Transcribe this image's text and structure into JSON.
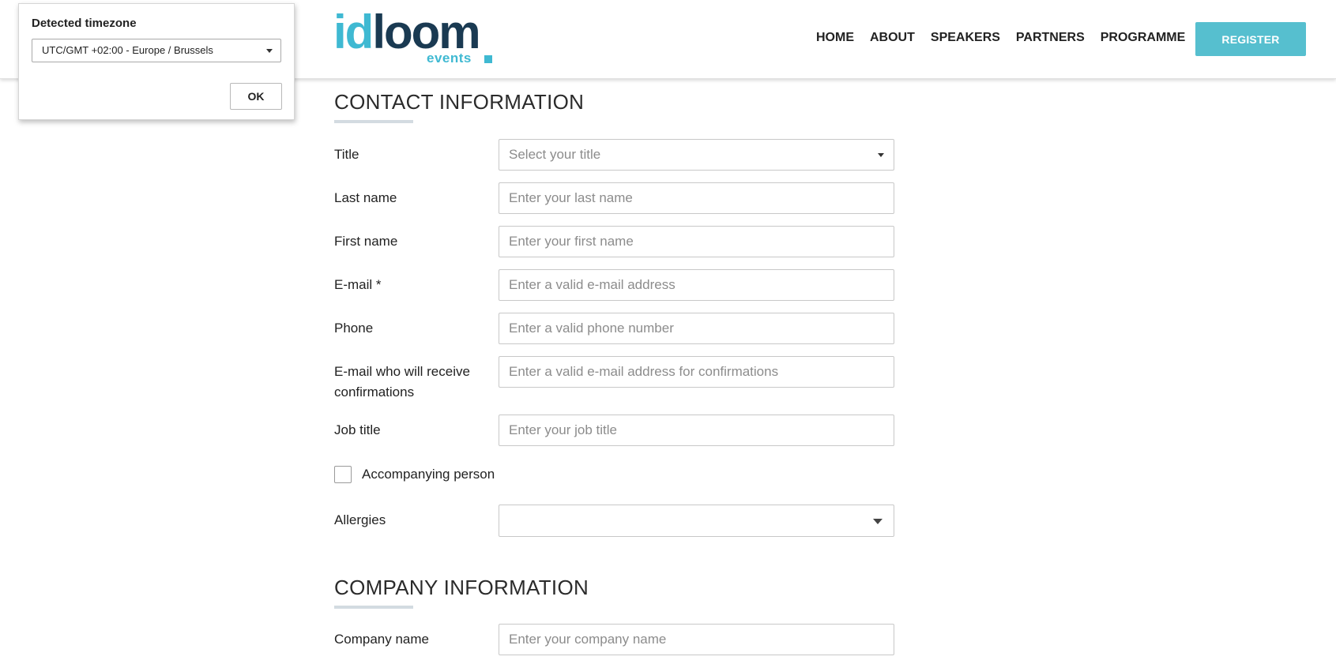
{
  "header": {
    "logo": {
      "part1": "id",
      "part2": "loom",
      "sub": "events"
    },
    "nav": [
      "HOME",
      "ABOUT",
      "SPEAKERS",
      "PARTNERS",
      "PROGRAMME"
    ],
    "register_label": "REGISTER"
  },
  "timezone_popup": {
    "title": "Detected timezone",
    "selected": "UTC/GMT +02:00 - Europe / Brussels",
    "ok_label": "OK"
  },
  "contact": {
    "title": "CONTACT INFORMATION",
    "title_field": {
      "label": "Title",
      "placeholder": "Select your title"
    },
    "last_name": {
      "label": "Last name",
      "placeholder": "Enter your last name"
    },
    "first_name": {
      "label": "First name",
      "placeholder": "Enter your first name"
    },
    "email": {
      "label": "E-mail *",
      "placeholder": "Enter a valid e-mail address"
    },
    "phone": {
      "label": "Phone",
      "placeholder": "Enter a valid phone number"
    },
    "confirm_email": {
      "label_line1": "E-mail who will receive",
      "label_line2": "confirmations",
      "placeholder": "Enter a valid e-mail address for confirmations"
    },
    "job_title": {
      "label": "Job title",
      "placeholder": "Enter your job title"
    },
    "accompanying": {
      "label": "Accompanying person",
      "checked": false
    },
    "allergies": {
      "label": "Allergies",
      "value": ""
    }
  },
  "company": {
    "title": "COMPANY INFORMATION",
    "company_name": {
      "label": "Company name",
      "placeholder": "Enter your company name"
    }
  },
  "colors": {
    "accent": "#3fb9d2",
    "brand_dark": "#1a3a52",
    "register_bg": "#56bfcf",
    "section_rule": "#d3dbe1"
  }
}
